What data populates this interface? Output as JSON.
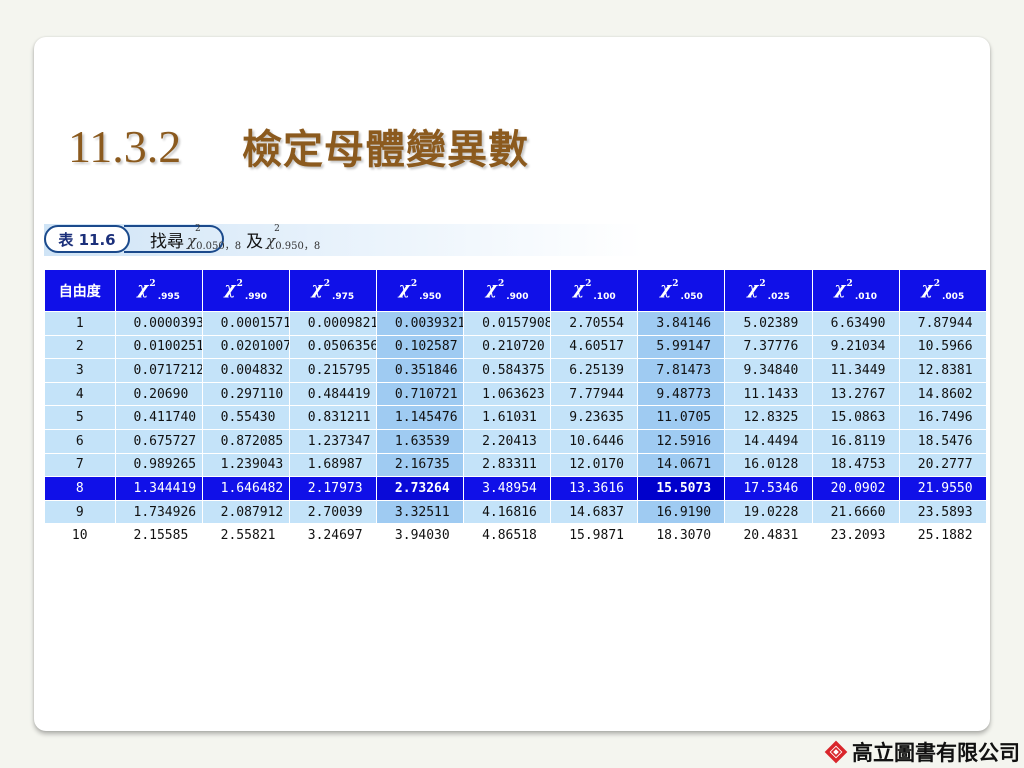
{
  "slide": {
    "section_number": "11.3.2",
    "section_title": "檢定母體變異數"
  },
  "caption": {
    "table_label": "表 11.6",
    "text_find": "找尋",
    "chi_symbol": "χ",
    "sup": "2",
    "sub1": "0.050，8",
    "text_and": "及",
    "sub2": "0.950，8"
  },
  "table": {
    "df_header": "自由度",
    "chi_symbol": "χ",
    "sup": "2",
    "columns": [
      ".995",
      ".990",
      ".975",
      ".950",
      ".900",
      ".100",
      ".050",
      ".025",
      ".010",
      ".005"
    ],
    "rows": [
      {
        "df": "1",
        "values": [
          "0.0000393",
          "0.0001571",
          "0.0009821",
          "0.0039321",
          "0.0157908",
          "2.70554",
          "3.84146",
          "5.02389",
          "6.63490",
          "7.87944"
        ]
      },
      {
        "df": "2",
        "values": [
          "0.0100251",
          "0.0201007",
          "0.0506356",
          "0.102587",
          "0.210720",
          "4.60517",
          "5.99147",
          "7.37776",
          "9.21034",
          "10.5966"
        ]
      },
      {
        "df": "3",
        "values": [
          "0.0717212",
          "0.004832",
          "0.215795",
          "0.351846",
          "0.584375",
          "6.25139",
          "7.81473",
          "9.34840",
          "11.3449",
          "12.8381"
        ]
      },
      {
        "df": "4",
        "values": [
          "0.20690",
          "0.297110",
          "0.484419",
          "0.710721",
          "1.063623",
          "7.77944",
          "9.48773",
          "11.1433",
          "13.2767",
          "14.8602"
        ]
      },
      {
        "df": "5",
        "values": [
          "0.411740",
          "0.55430",
          "0.831211",
          "1.145476",
          "1.61031",
          "9.23635",
          "11.0705",
          "12.8325",
          "15.0863",
          "16.7496"
        ]
      },
      {
        "df": "6",
        "values": [
          "0.675727",
          "0.872085",
          "1.237347",
          "1.63539",
          "2.20413",
          "10.6446",
          "12.5916",
          "14.4494",
          "16.8119",
          "18.5476"
        ]
      },
      {
        "df": "7",
        "values": [
          "0.989265",
          "1.239043",
          "1.68987",
          "2.16735",
          "2.83311",
          "12.0170",
          "14.0671",
          "16.0128",
          "18.4753",
          "20.2777"
        ]
      },
      {
        "df": "8",
        "values": [
          "1.344419",
          "1.646482",
          "2.17973",
          "2.73264",
          "3.48954",
          "13.3616",
          "15.5073",
          "17.5346",
          "20.0902",
          "21.9550"
        ]
      },
      {
        "df": "9",
        "values": [
          "1.734926",
          "2.087912",
          "2.70039",
          "3.32511",
          "4.16816",
          "14.6837",
          "16.9190",
          "19.0228",
          "21.6660",
          "23.5893"
        ]
      },
      {
        "df": "10",
        "values": [
          "2.15585",
          "2.55821",
          "3.24697",
          "3.94030",
          "4.86518",
          "15.9871",
          "18.3070",
          "20.4831",
          "23.2093",
          "25.1882"
        ]
      }
    ],
    "highlight_columns": [
      ".950",
      ".050"
    ],
    "highlight_row_df": "8"
  },
  "publisher": {
    "name": "高立圖書有限公司",
    "logo_icon": "diamond-logo-icon"
  },
  "colors": {
    "header_blue": "#1010e8",
    "cell_light": "#c4e3f9",
    "cell_highlight": "#9fcbf2",
    "title_brown": "#8b5a1e",
    "logo_red": "#d9262b"
  }
}
